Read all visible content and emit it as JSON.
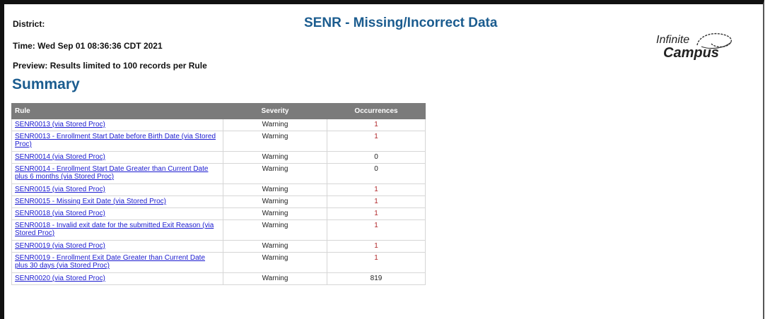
{
  "header": {
    "district_label": "District:",
    "time": "Time: Wed Sep 01 08:36:36 CDT 2021",
    "preview": "Preview: Results limited to 100 records per Rule",
    "title": "SENR - Missing/Incorrect Data",
    "summary": "Summary"
  },
  "logo": {
    "line1": "Infinite",
    "line2": "Campus"
  },
  "table": {
    "columns": {
      "rule": "Rule",
      "severity": "Severity",
      "occurrences": "Occurrences"
    },
    "rows": [
      {
        "rule": "SENR0013 (via Stored Proc)",
        "severity": "Warning",
        "occurrences": "1"
      },
      {
        "rule": "SENR0013 - Enrollment Start Date before Birth Date (via Stored Proc)",
        "severity": "Warning",
        "occurrences": "1"
      },
      {
        "rule": "SENR0014 (via Stored Proc)",
        "severity": "Warning",
        "occurrences": "0"
      },
      {
        "rule": "SENR0014 - Enrollment Start Date Greater than Current Date plus 6 months (via Stored Proc)",
        "severity": "Warning",
        "occurrences": "0"
      },
      {
        "rule": "SENR0015 (via Stored Proc)",
        "severity": "Warning",
        "occurrences": "1"
      },
      {
        "rule": "SENR0015 - Missing Exit Date (via Stored Proc)",
        "severity": "Warning",
        "occurrences": "1"
      },
      {
        "rule": "SENR0018 (via Stored Proc)",
        "severity": "Warning",
        "occurrences": "1"
      },
      {
        "rule": "SENR0018 - Invalid exit date for the submitted Exit Reason (via Stored Proc)",
        "severity": "Warning",
        "occurrences": "1"
      },
      {
        "rule": "SENR0019 (via Stored Proc)",
        "severity": "Warning",
        "occurrences": "1"
      },
      {
        "rule": "SENR0019 - Enrollment Exit Date Greater than Current Date plus 30 days (via Stored Proc)",
        "severity": "Warning",
        "occurrences": "1"
      },
      {
        "rule": "SENR0020 (via Stored Proc)",
        "severity": "Warning",
        "occurrences": "819"
      }
    ]
  },
  "colors": {
    "title": "#1b5c8f",
    "header_bg": "#7b7b7b",
    "link": "#1a1ad0",
    "nonzero": "#b0282a"
  }
}
